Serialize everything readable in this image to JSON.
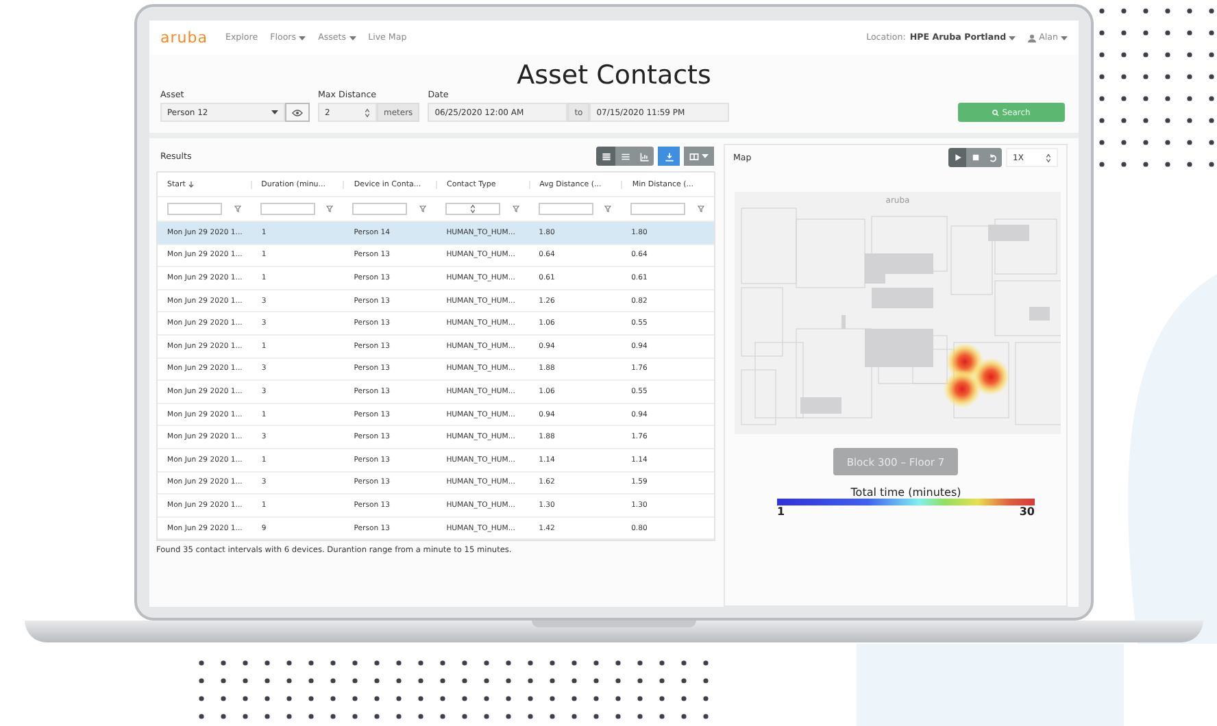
{
  "nav": {
    "logo": "aruba",
    "items": [
      {
        "label": "Explore",
        "dropdown": false
      },
      {
        "label": "Floors",
        "dropdown": true
      },
      {
        "label": "Assets",
        "dropdown": true
      },
      {
        "label": "Live Map",
        "dropdown": false
      }
    ],
    "location_label": "Location:",
    "location": "HPE Aruba Portland",
    "user": "Alan"
  },
  "title": "Asset Contacts",
  "form": {
    "asset": {
      "label": "Asset",
      "value": "Person 12"
    },
    "max_distance": {
      "label": "Max Distance",
      "value": "2",
      "unit": "meters"
    },
    "date": {
      "label": "Date",
      "from": "06/25/2020 12:00 AM",
      "separator": "to",
      "to": "07/15/2020 11:59 PM"
    },
    "search_button": "Search"
  },
  "results": {
    "title": "Results",
    "view_buttons": [
      {
        "kind": "grid",
        "selected": true
      },
      {
        "kind": "list",
        "selected": false
      },
      {
        "kind": "chart",
        "selected": false
      },
      {
        "kind": "download",
        "selected": true
      },
      {
        "kind": "columns",
        "selected": false
      }
    ],
    "columns": [
      {
        "label": "Start",
        "sorted_descending": true
      },
      {
        "label": "Duration (minu...",
        "sorted_descending": false
      },
      {
        "label": "Device in Conta...",
        "sorted_descending": false
      },
      {
        "label": "Contact Type",
        "sorted_descending": false
      },
      {
        "label": "Avg Distance (...",
        "sorted_descending": false
      },
      {
        "label": "Min Distance (...",
        "sorted_descending": false
      }
    ],
    "filters": [
      {
        "kind": "text"
      },
      {
        "kind": "text"
      },
      {
        "kind": "text"
      },
      {
        "kind": "select"
      },
      {
        "kind": "text"
      },
      {
        "kind": "text"
      }
    ],
    "rows": [
      {
        "selected": true,
        "cells": [
          "Mon Jun 29 2020 1...",
          "1",
          "Person 14",
          "HUMAN_TO_HUM...",
          "1.80",
          "1.80"
        ]
      },
      {
        "selected": false,
        "cells": [
          "Mon Jun 29 2020 1...",
          "1",
          "Person 13",
          "HUMAN_TO_HUM...",
          "0.64",
          "0.64"
        ]
      },
      {
        "selected": false,
        "cells": [
          "Mon Jun 29 2020 1...",
          "1",
          "Person 13",
          "HUMAN_TO_HUM...",
          "0.61",
          "0.61"
        ]
      },
      {
        "selected": false,
        "cells": [
          "Mon Jun 29 2020 1...",
          "3",
          "Person 13",
          "HUMAN_TO_HUM...",
          "1.26",
          "0.82"
        ]
      },
      {
        "selected": false,
        "cells": [
          "Mon Jun 29 2020 1...",
          "3",
          "Person 13",
          "HUMAN_TO_HUM...",
          "1.06",
          "0.55"
        ]
      },
      {
        "selected": false,
        "cells": [
          "Mon Jun 29 2020 1...",
          "1",
          "Person 13",
          "HUMAN_TO_HUM...",
          "0.94",
          "0.94"
        ]
      },
      {
        "selected": false,
        "cells": [
          "Mon Jun 29 2020 1...",
          "3",
          "Person 13",
          "HUMAN_TO_HUM...",
          "1.88",
          "1.76"
        ]
      },
      {
        "selected": false,
        "cells": [
          "Mon Jun 29 2020 1...",
          "3",
          "Person 13",
          "HUMAN_TO_HUM...",
          "1.06",
          "0.55"
        ]
      },
      {
        "selected": false,
        "cells": [
          "Mon Jun 29 2020 1...",
          "1",
          "Person 13",
          "HUMAN_TO_HUM...",
          "0.94",
          "0.94"
        ]
      },
      {
        "selected": false,
        "cells": [
          "Mon Jun 29 2020 1...",
          "3",
          "Person 13",
          "HUMAN_TO_HUM...",
          "1.88",
          "1.76"
        ]
      },
      {
        "selected": false,
        "cells": [
          "Mon Jun 29 2020 1...",
          "1",
          "Person 13",
          "HUMAN_TO_HUM...",
          "1.14",
          "1.14"
        ]
      },
      {
        "selected": false,
        "cells": [
          "Mon Jun 29 2020 1...",
          "3",
          "Person 13",
          "HUMAN_TO_HUM...",
          "1.62",
          "1.59"
        ]
      },
      {
        "selected": false,
        "cells": [
          "Mon Jun 29 2020 1...",
          "1",
          "Person 13",
          "HUMAN_TO_HUM...",
          "1.30",
          "1.30"
        ]
      },
      {
        "selected": false,
        "cells": [
          "Mon Jun 29 2020 1...",
          "9",
          "Person 13",
          "HUMAN_TO_HUM...",
          "1.42",
          "0.80"
        ]
      }
    ],
    "summary": "Found 35 contact intervals with 6 devices. Durantion range from a minute to 15 minutes."
  },
  "map": {
    "title": "Map",
    "playback": [
      {
        "kind": "play",
        "selected": true
      },
      {
        "kind": "stop",
        "selected": false
      },
      {
        "kind": "replay",
        "selected": false
      }
    ],
    "speed": "1X",
    "map_logo": "aruba",
    "floor_label": "Block 300 – Floor 7",
    "legend": {
      "title": "Total time (minutes)",
      "min": "1",
      "max": "30"
    }
  }
}
